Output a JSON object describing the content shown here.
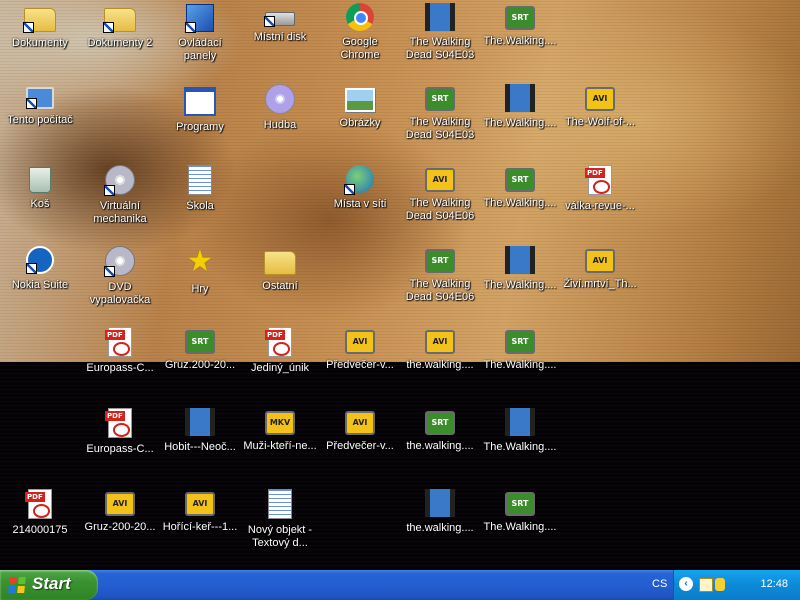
{
  "desktop": {
    "icons": [
      {
        "label": "Dokumenty",
        "icon": "documents-folder-icon"
      },
      {
        "label": "Dokumenty 2",
        "icon": "folder-icon"
      },
      {
        "label": "Ovládací panely",
        "icon": "control-panel-icon"
      },
      {
        "label": "Místní disk",
        "icon": "local-disk-icon"
      },
      {
        "label": "Google Chrome",
        "icon": "chrome-icon"
      },
      {
        "label": "The Walking Dead S04E03",
        "icon": "video-file-icon"
      },
      {
        "label": "The.Walking....",
        "icon": "srt-subtitle-icon"
      },
      {
        "label": "Tento počítač",
        "icon": "my-computer-icon"
      },
      {
        "label": "Programy",
        "icon": "programs-icon"
      },
      {
        "label": "Hudba",
        "icon": "music-cd-icon"
      },
      {
        "label": "Obrázky",
        "icon": "pictures-icon"
      },
      {
        "label": "The Walking Dead S04E03",
        "icon": "srt-subtitle-icon"
      },
      {
        "label": "The.Walking....",
        "icon": "video-file-icon"
      },
      {
        "label": "The-Wolf-of-...",
        "icon": "avi-file-icon"
      },
      {
        "label": "Koš",
        "icon": "recycle-bin-icon"
      },
      {
        "label": "Virtuální mechanika",
        "icon": "virtual-drive-icon"
      },
      {
        "label": "Škola",
        "icon": "document-icon"
      },
      {
        "label": "Místa v síti",
        "icon": "network-places-icon"
      },
      {
        "label": "The Walking Dead S04E06",
        "icon": "avi-file-icon"
      },
      {
        "label": "The.Walking....",
        "icon": "srt-subtitle-icon"
      },
      {
        "label": "válka-revue-...",
        "icon": "pdf-file-icon"
      },
      {
        "label": "Nokia Suite",
        "icon": "nokia-suite-icon"
      },
      {
        "label": "DVD vypalovačka",
        "icon": "dvd-burner-icon"
      },
      {
        "label": "Hry",
        "icon": "star-icon"
      },
      {
        "label": "Ostatní",
        "icon": "folder-icon"
      },
      {
        "label": "The Walking Dead S04E06",
        "icon": "srt-subtitle-icon"
      },
      {
        "label": "The.Walking....",
        "icon": "video-file-icon"
      },
      {
        "label": "Živí.mrtví_Th...",
        "icon": "avi-file-icon"
      },
      {
        "label": "Europass-C...",
        "icon": "pdf-file-icon"
      },
      {
        "label": "Gruz.200-20...",
        "icon": "srt-subtitle-icon"
      },
      {
        "label": "Jediný_únik",
        "icon": "pdf-file-icon"
      },
      {
        "label": "Předvečer-v...",
        "icon": "avi-file-icon"
      },
      {
        "label": "the.walking....",
        "icon": "avi-file-icon"
      },
      {
        "label": "The.Walking....",
        "icon": "srt-subtitle-icon"
      },
      {
        "label": "Europass-C...",
        "icon": "pdf-file-icon"
      },
      {
        "label": "Hobit---Neoč...",
        "icon": "video-file-icon"
      },
      {
        "label": "Muži-kteří-ne...",
        "icon": "mkv-file-icon"
      },
      {
        "label": "Předvečer-v...",
        "icon": "avi-file-icon"
      },
      {
        "label": "the.walking....",
        "icon": "srt-subtitle-icon"
      },
      {
        "label": "The.Walking....",
        "icon": "video-file-icon"
      },
      {
        "label": "214000175",
        "icon": "pdf-file-icon"
      },
      {
        "label": "Gruz-200-20...",
        "icon": "avi-file-icon"
      },
      {
        "label": "Hořící-keř---1...",
        "icon": "avi-file-icon"
      },
      {
        "label": "Nový objekt - Textový d...",
        "icon": "text-document-icon"
      },
      {
        "label": "the.walking....",
        "icon": "video-file-icon"
      },
      {
        "label": "The.Walking....",
        "icon": "srt-subtitle-icon"
      }
    ],
    "badges": {
      "srt": "SRT",
      "avi": "AVI",
      "mkv": "MKV"
    }
  },
  "taskbar": {
    "start_label": "Start",
    "language": "CS",
    "tray_chevron": "‹",
    "clock": "12:48",
    "colors": {
      "taskbar": "#245ed0",
      "start": "#39922f",
      "tray": "#0c8ad8"
    }
  }
}
